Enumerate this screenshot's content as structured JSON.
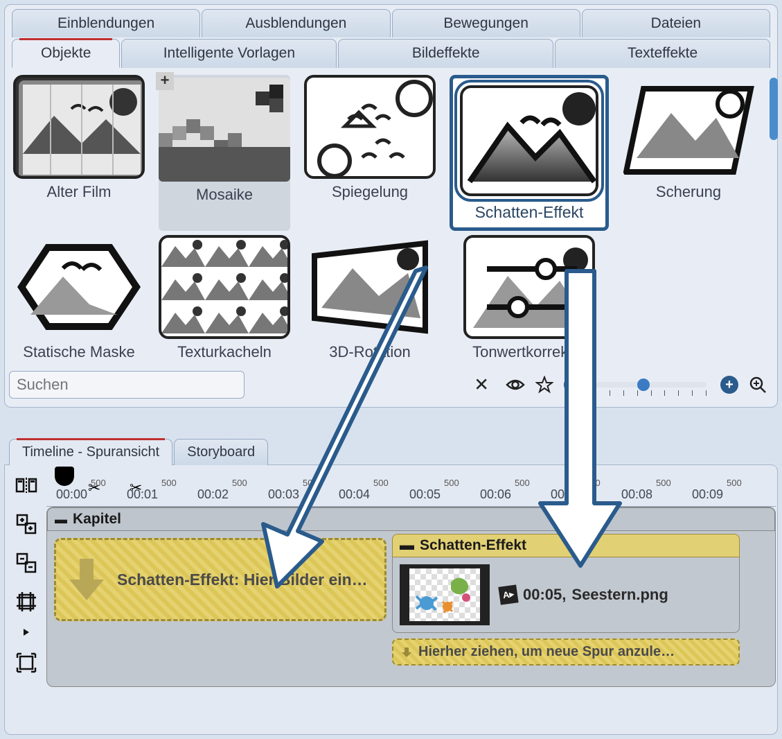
{
  "topTabs1": [
    "Einblendungen",
    "Ausblendungen",
    "Bewegungen",
    "Dateien"
  ],
  "topTabs2": [
    "Objekte",
    "Intelligente Vorlagen",
    "Bildeffekte",
    "Texteffekte"
  ],
  "activeTopTab": "Objekte",
  "effects": [
    {
      "label": "Alter Film"
    },
    {
      "label": "Mosaike",
      "mosaic": true
    },
    {
      "label": "Spiegelung"
    },
    {
      "label": "Schatten-Effekt",
      "highlighted": true
    },
    {
      "label": "Scherung"
    },
    {
      "label": "Statische Maske"
    },
    {
      "label": "Texturkacheln"
    },
    {
      "label": "3D-Rotation"
    },
    {
      "label": "Tonwertkorrektur"
    }
  ],
  "search": {
    "placeholder": "Suchen"
  },
  "bottomTabs": [
    "Timeline - Spuransicht",
    "Storyboard"
  ],
  "activeBottomTab": "Timeline - Spuransicht",
  "ruler": {
    "labels": [
      "00:00",
      "00:01",
      "00:02",
      "00:03",
      "00:04",
      "00:05",
      "00:06",
      "00:07",
      "00:08",
      "00:09"
    ],
    "sub": "500"
  },
  "chapter": {
    "title": "Kapitel"
  },
  "dropZone": {
    "text": "Schatten-Effekt: Hier Bilder ein…"
  },
  "clip": {
    "title": "Schatten-Effekt",
    "duration": "00:05,",
    "filename": "Seestern.png"
  },
  "newTrackHint": "Hierher ziehen, um neue Spur anzule…"
}
